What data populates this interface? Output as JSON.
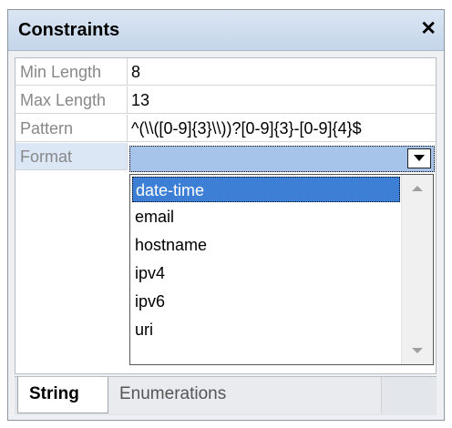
{
  "panel": {
    "title": "Constraints",
    "close_label": "✕"
  },
  "properties": [
    {
      "label": "Min Length",
      "value": "8"
    },
    {
      "label": "Max Length",
      "value": "13"
    },
    {
      "label": "Pattern",
      "value": "^(\\\\([0-9]{3}\\\\))?[0-9]{3}-[0-9]{4}$"
    },
    {
      "label": "Format",
      "value": ""
    }
  ],
  "format_dropdown": {
    "selected_value": "",
    "options": [
      "date-time",
      "email",
      "hostname",
      "ipv4",
      "ipv6",
      "uri"
    ],
    "highlighted": "date-time"
  },
  "tabs": [
    {
      "label": "String",
      "active": true
    },
    {
      "label": "Enumerations",
      "active": false
    }
  ],
  "colors": {
    "highlight": "#3c7fd4",
    "combo_background": "#a6c3e9",
    "titlebar": "#c4d5ea"
  }
}
